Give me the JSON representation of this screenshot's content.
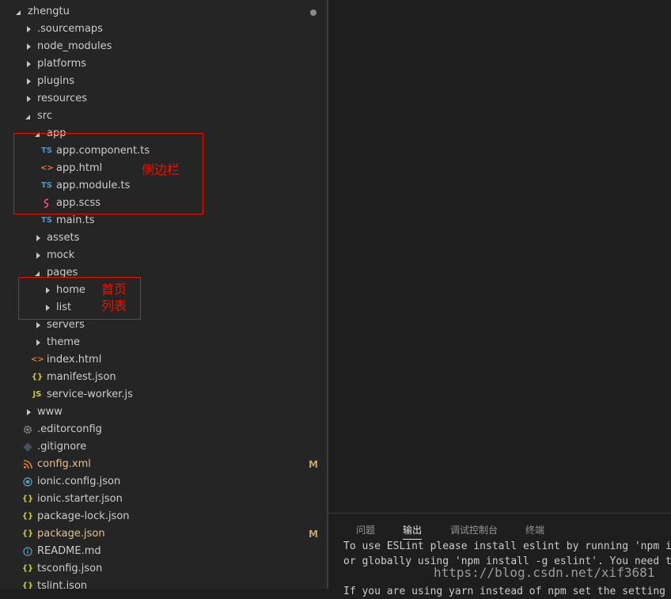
{
  "explorer": {
    "root": "zhengtu",
    "items": [
      {
        "label": ".sourcemaps",
        "icon": "chevron-right-icon"
      },
      {
        "label": "node_modules",
        "icon": "chevron-right-icon"
      },
      {
        "label": "platforms",
        "icon": "chevron-right-icon"
      },
      {
        "label": "plugins",
        "icon": "chevron-right-icon"
      },
      {
        "label": "resources",
        "icon": "chevron-right-icon"
      },
      {
        "label": "src",
        "icon": "chevron-down-icon"
      },
      {
        "label": "app",
        "icon": "chevron-down-icon"
      },
      {
        "label": "app.component.ts",
        "icon": "typescript-file-icon",
        "icon_text": "TS"
      },
      {
        "label": "app.html",
        "icon": "html-file-icon",
        "icon_text": "<>"
      },
      {
        "label": "app.module.ts",
        "icon": "typescript-file-icon",
        "icon_text": "TS"
      },
      {
        "label": "app.scss",
        "icon": "sass-file-icon"
      },
      {
        "label": "main.ts",
        "icon": "typescript-file-icon",
        "icon_text": "TS"
      },
      {
        "label": "assets",
        "icon": "chevron-right-icon"
      },
      {
        "label": "mock",
        "icon": "chevron-right-icon"
      },
      {
        "label": "pages",
        "icon": "chevron-down-icon"
      },
      {
        "label": "home",
        "icon": "chevron-right-icon"
      },
      {
        "label": "list",
        "icon": "chevron-right-icon"
      },
      {
        "label": "servers",
        "icon": "chevron-right-icon"
      },
      {
        "label": "theme",
        "icon": "chevron-right-icon"
      },
      {
        "label": "index.html",
        "icon": "html-file-icon",
        "icon_text": "<>"
      },
      {
        "label": "manifest.json",
        "icon": "json-file-icon",
        "icon_text": "{}"
      },
      {
        "label": "service-worker.js",
        "icon": "javascript-file-icon",
        "icon_text": "JS"
      },
      {
        "label": "www",
        "icon": "chevron-right-icon"
      },
      {
        "label": ".editorconfig",
        "icon": "gear-icon"
      },
      {
        "label": ".gitignore",
        "icon": "git-icon"
      },
      {
        "label": "config.xml",
        "icon": "rss-icon",
        "badge": "M"
      },
      {
        "label": "ionic.config.json",
        "icon": "ionic-icon"
      },
      {
        "label": "ionic.starter.json",
        "icon": "json-file-icon",
        "icon_text": "{}"
      },
      {
        "label": "package-lock.json",
        "icon": "json-file-icon",
        "icon_text": "{}"
      },
      {
        "label": "package.json",
        "icon": "json-file-icon",
        "icon_text": "{}",
        "badge": "M"
      },
      {
        "label": "README.md",
        "icon": "info-icon"
      },
      {
        "label": "tsconfig.json",
        "icon": "json-file-icon",
        "icon_text": "{}"
      },
      {
        "label": "tslint.json",
        "icon": "json-file-icon",
        "icon_text": "{}"
      }
    ]
  },
  "annotations": {
    "sidebar": "侧边栏",
    "home": "首页",
    "list": "列表"
  },
  "panel": {
    "tabs": [
      "问题",
      "输出",
      "调试控制台",
      "终端"
    ],
    "active_tab": "输出",
    "lines": [
      "To use ESLint please install eslint by running 'npm in",
      "or globally using 'npm install -g eslint'. You need to",
      "",
      "If you are using yarn instead of npm set the setting `"
    ]
  },
  "watermark": "https://blog.csdn.net/xif3681",
  "colors": {
    "sidebar_bg": "#252526",
    "editor_bg": "#1e1e1e",
    "annotation_red": "#e51400",
    "modified": "#e2c08d"
  }
}
